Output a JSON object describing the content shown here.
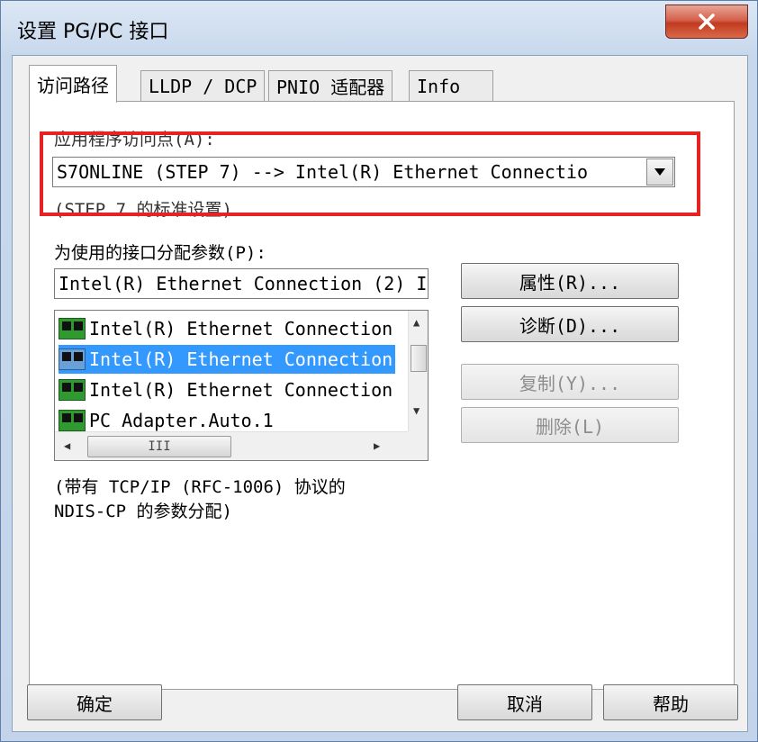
{
  "window": {
    "title": "设置 PG/PC 接口",
    "close_label": "✕"
  },
  "tabs": [
    {
      "label": "访问路径",
      "active": true
    },
    {
      "label": "LLDP / DCP",
      "active": false
    },
    {
      "label": "PNIO 适配器",
      "active": false
    },
    {
      "label": "Info",
      "active": false
    }
  ],
  "access_point": {
    "label": "应用程序访问点(A):",
    "value": "S7ONLINE (STEP 7)        --> Intel(R) Ethernet Connectio",
    "note": "(STEP 7 的标准设置)",
    "highlight_color": "#e52323"
  },
  "interface": {
    "label": "为使用的接口分配参数(P):",
    "value": "Intel(R) Ethernet Connection (2) I",
    "items": [
      {
        "label": "Intel(R) Ethernet Connection",
        "icon": "network-card-icon",
        "selected": false
      },
      {
        "label": "Intel(R) Ethernet Connection",
        "icon": "network-card-icon",
        "selected": true
      },
      {
        "label": "Intel(R) Ethernet Connection",
        "icon": "network-card-icon",
        "selected": false
      },
      {
        "label": "PC Adapter.Auto.1",
        "icon": "network-card-icon",
        "selected": false
      }
    ],
    "hscroll_thumb": "III"
  },
  "buttons": {
    "properties": "属性(R)...",
    "diagnostics": "诊断(D)...",
    "copy": "复制(Y)...",
    "delete": "删除(L)",
    "ok": "确定",
    "cancel": "取消",
    "help": "帮助"
  },
  "description": {
    "line1": "(带有 TCP/IP (RFC-1006) 协议的",
    "line2": "NDIS-CP 的参数分配)"
  }
}
